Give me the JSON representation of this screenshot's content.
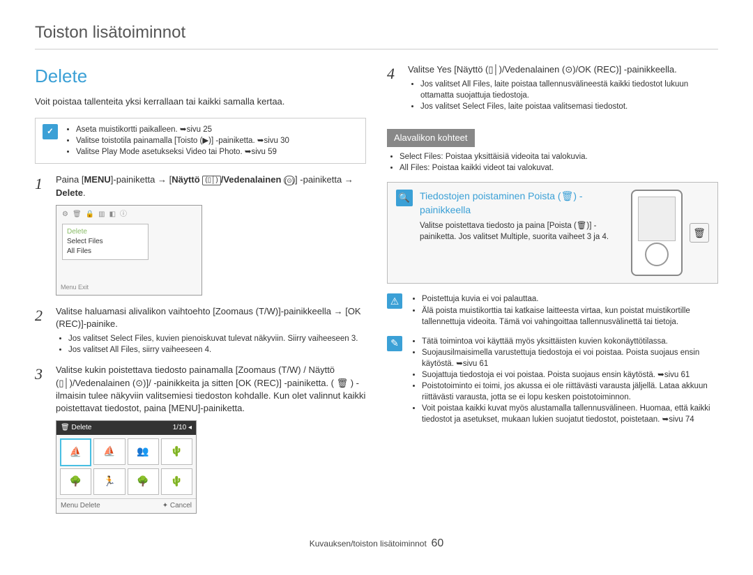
{
  "header": "Toiston lisätoiminnot",
  "section_title": "Delete",
  "intro": "Voit poistaa tallenteita yksi kerrallaan tai kaikki samalla kertaa.",
  "prereq_icon": "✓",
  "prereq": [
    "Aseta muistikortti paikalleen. ➥sivu 25",
    "Valitse toistotila painamalla [Toisto (▶)] -painiketta. ➥sivu 30",
    "Valitse Play Mode asetukseksi Video tai Photo. ➥sivu 59"
  ],
  "steps": [
    {
      "num": "1",
      "text_pre": "Paina [",
      "b1": "MENU",
      "text_mid": "]-painiketta → [",
      "b2": "Näyttö",
      "g1": "(▯│)",
      "b3": "/Vedenalainen",
      "g2": "(⊙)",
      "text_post": "] -painiketta → ",
      "b4": "Delete",
      "tail": "."
    },
    {
      "num": "2",
      "text": "Valitse haluamasi alivalikon vaihtoehto [Zoomaus (T/W)]-painikkeella → [OK (REC)]-painike.",
      "bullets": [
        "Jos valitset Select Files, kuvien pienoiskuvat tulevat näkyviin. Siirry vaiheeseen 3.",
        "Jos valitset All Files, siirry vaiheeseen 4."
      ]
    },
    {
      "num": "3",
      "text": "Valitse kukin poistettava tiedosto painamalla [Zoomaus (T/W) / Näyttö (▯│)/Vedenalainen (⊙)]/ -painikkeita ja sitten [OK (REC)] -painiketta. ( 🗑 ) -ilmaisin tulee näkyviin valitsemiesi tiedoston kohdalle. Kun olet valinnut kaikki poistettavat tiedostot, paina [MENU]-painiketta."
    },
    {
      "num": "4",
      "text": "Valitse Yes [Näyttö (▯│)/Vedenalainen (⊙)/OK (REC)] -painikkeella.",
      "bullets": [
        "Jos valitset All Files, laite poistaa tallennusvälineestä kaikki tiedostot lukuun ottamatta suojattuja tiedostoja.",
        "Jos valitset Select Files, laite poistaa valitsemasi tiedostot."
      ]
    }
  ],
  "screen1": {
    "icons": [
      "⚙",
      "🗑",
      "🔒",
      "▥",
      "◧",
      "ⓘ"
    ],
    "title": "Delete",
    "items": [
      "Select Files",
      "All Files"
    ],
    "footer_left": "Menu",
    "footer_right": "Exit"
  },
  "screen2": {
    "top_left": "🗑  Delete",
    "top_right": "1/10 ◂",
    "thumbs": [
      "⛵",
      "⛵",
      "👥",
      "🌵",
      "🌳",
      "🏃",
      "🌳",
      "🌵"
    ],
    "bot_left": "Menu   Delete",
    "bot_right": "✦ Cancel"
  },
  "submenu": {
    "header": "Alavalikon kohteet",
    "items": [
      "Select Files: Poistaa yksittäisiä videoita tai valokuvia.",
      "All Files: Poistaa kaikki videot tai valokuvat."
    ]
  },
  "infocard": {
    "icon": "🔍",
    "title": "Tiedostojen poistaminen Poista (🗑) -painikkeella",
    "body": "Valitse poistettava tiedosto ja paina [Poista (🗑)] -painiketta. Jos valitset Multiple, suorita vaiheet 3 ja 4.",
    "btn_label": "🗑"
  },
  "notes_warn": [
    "Poistettuja kuvia ei voi palauttaa.",
    "Älä poista muistikorttia tai katkaise laitteesta virtaa, kun poistat muistikortille tallennettuja videoita. Tämä voi vahingoittaa tallennusvälinettä tai tietoja."
  ],
  "notes_edit": [
    "Tätä toimintoa voi käyttää myös yksittäisten kuvien kokonäyttötilassa.",
    "Suojausilmaisimella varustettuja tiedostoja ei voi poistaa. Poista suojaus ensin käytöstä. ➥sivu 61",
    "Suojattuja tiedostoja ei voi poistaa. Poista suojaus ensin käytöstä. ➥sivu 61",
    "Poistotoiminto ei toimi, jos akussa ei ole riittävästi varausta jäljellä. Lataa akkuun riittävästi varausta, jotta se ei lopu kesken poistotoiminnon.",
    "Voit poistaa kaikki kuvat myös alustamalla tallennusvälineen. Huomaa, että kaikki tiedostot ja asetukset, mukaan lukien suojatut tiedostot, poistetaan. ➥sivu 74"
  ],
  "footer": {
    "text": "Kuvauksen/toiston lisätoiminnot",
    "page": "60"
  }
}
